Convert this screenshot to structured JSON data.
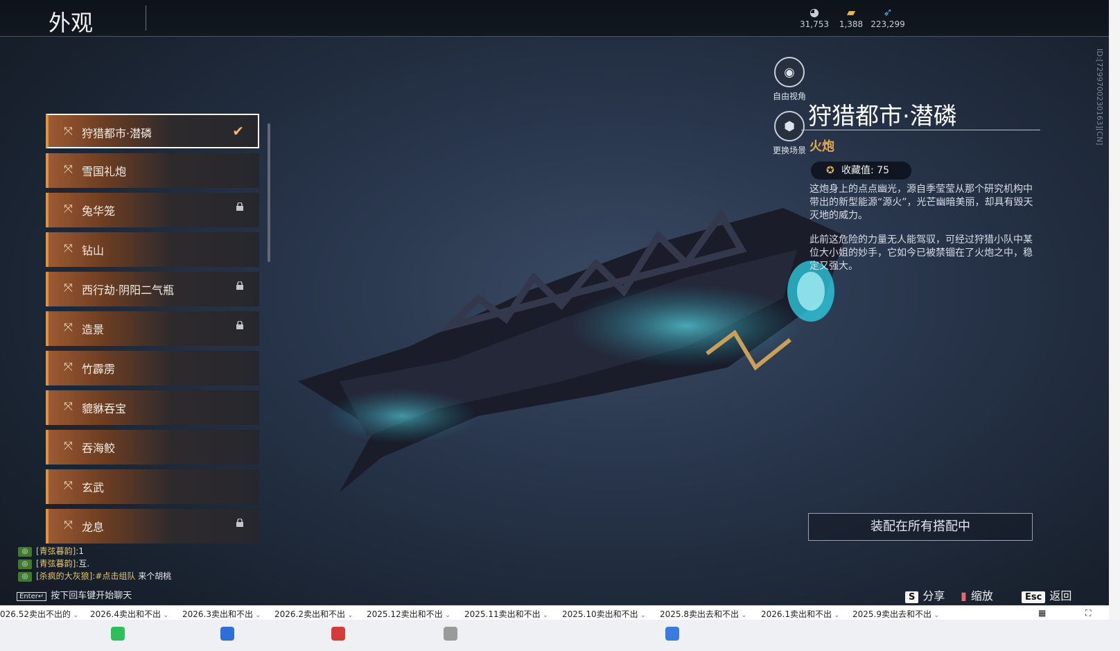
{
  "header": {
    "title": "外观",
    "currencies": [
      {
        "icon": "gem-icon",
        "value": "31,753"
      },
      {
        "icon": "ticket-icon",
        "value": "1,388"
      },
      {
        "icon": "feather-icon",
        "value": "223,299"
      }
    ]
  },
  "side_id": "ID:[7299700230163][CN]",
  "list": {
    "items": [
      {
        "label": "狩猎都市·潜磷",
        "selected": true,
        "locked": false
      },
      {
        "label": "雪国礼炮",
        "selected": false,
        "locked": false
      },
      {
        "label": "兔华笼",
        "selected": false,
        "locked": true
      },
      {
        "label": "钻山",
        "selected": false,
        "locked": false
      },
      {
        "label": "西行劫·阴阳二气瓶",
        "selected": false,
        "locked": true
      },
      {
        "label": "造景",
        "selected": false,
        "locked": true
      },
      {
        "label": "竹霹雳",
        "selected": false,
        "locked": false
      },
      {
        "label": "貔貅吞宝",
        "selected": false,
        "locked": false
      },
      {
        "label": "吞海鲛",
        "selected": false,
        "locked": false
      },
      {
        "label": "玄武",
        "selected": false,
        "locked": false
      },
      {
        "label": "龙息",
        "selected": false,
        "locked": true
      }
    ]
  },
  "view_buttons": {
    "free_view": "自由视角",
    "change_scene": "更换场景"
  },
  "detail": {
    "name": "狩猎都市·潜磷",
    "category": "火炮",
    "collect_label": "收藏值: 75",
    "desc1": "这炮身上的点点幽光，源自季莹莹从那个研究机构中带出的新型能源“源火”，光芒幽暗美丽，却具有毁天灭地的威力。",
    "desc2": "此前这危险的力量无人能驾驭，可经过狩猎小队中某位大小姐的妙手，它如今已被禁锢在了火炮之中，稳定又强大。",
    "equip_button": "装配在所有搭配中"
  },
  "chat": {
    "lines": [
      {
        "who": "[青弦暮韵]:",
        "msg": "1"
      },
      {
        "who": "[青弦暮韵]:",
        "msg": "互."
      },
      {
        "who": "[杀疯的大灰狼]:",
        "link": "#点击组队",
        "msg": " 来个胡桃"
      }
    ],
    "enter_key": "Enter↵",
    "enter_hint": "按下回车键开始聊天"
  },
  "hints": {
    "share_key": "S",
    "share": "分享",
    "zoom": "缩放",
    "esc_key": "Esc",
    "back": "返回"
  },
  "taskbar_tabs": [
    "026.52卖出不出的",
    "2026.4卖出和不出",
    "2026.3卖出和不出",
    "2026.2卖出和不出",
    "2025.12卖出和不出",
    "2025.11卖出和不出",
    "2025.10卖出和不出",
    "2025.8卖出去和不出",
    "2026.1卖出和不出",
    "2025.9卖出去和不出"
  ]
}
